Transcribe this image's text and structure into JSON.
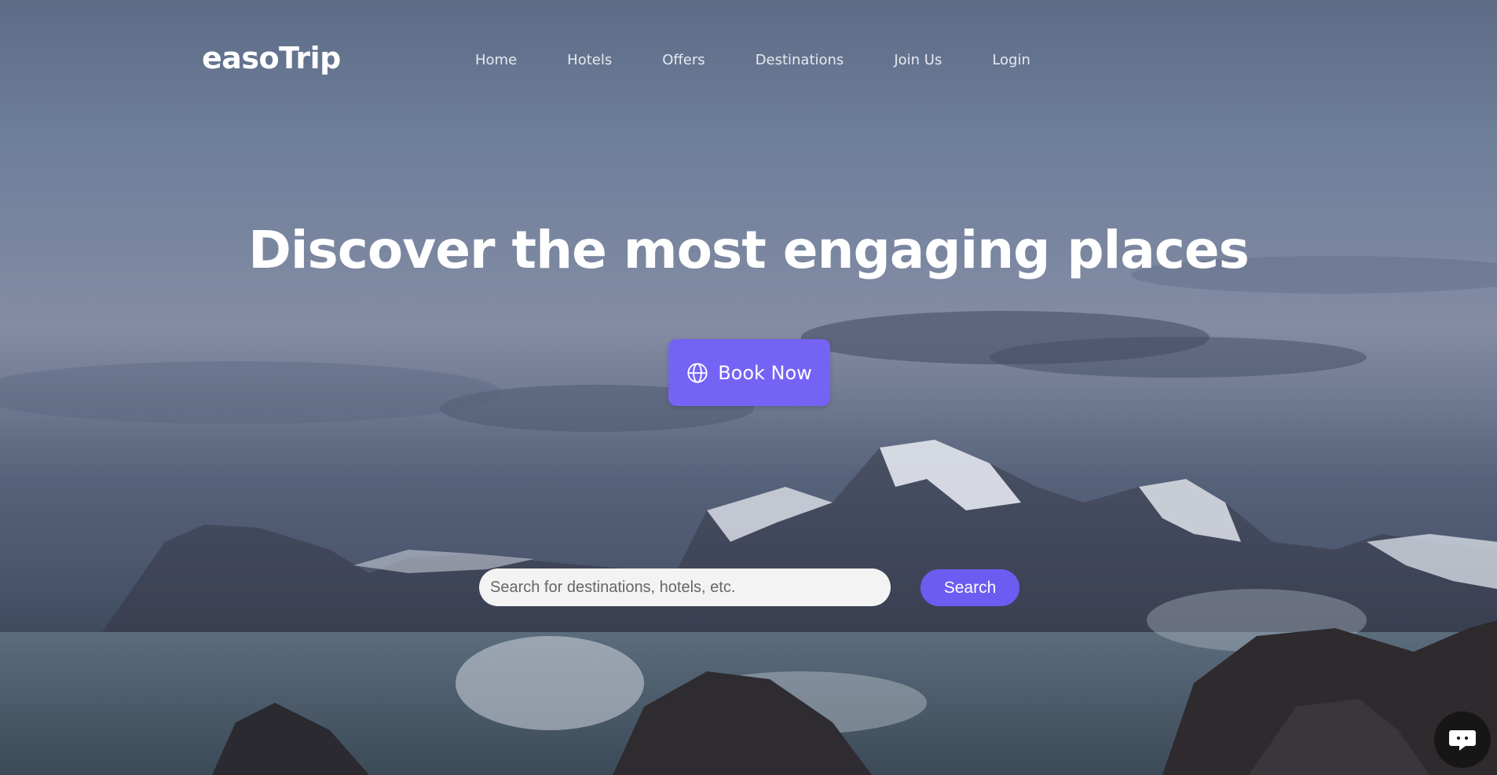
{
  "brand": {
    "logo_text": "easoTrip"
  },
  "nav": {
    "items": [
      {
        "label": "Home"
      },
      {
        "label": "Hotels"
      },
      {
        "label": "Offers"
      },
      {
        "label": "Destinations"
      },
      {
        "label": "Join Us"
      },
      {
        "label": "Login"
      }
    ]
  },
  "hero": {
    "headline": "Discover the most engaging places",
    "book_button_label": "Book Now",
    "book_button_icon": "globe-icon"
  },
  "search": {
    "placeholder": "Search for destinations, hotels, etc.",
    "value": "",
    "button_label": "Search"
  },
  "chat": {
    "icon": "chat-bubble-icon"
  },
  "colors": {
    "accent": "#7563f5",
    "search_button": "#6c5cf1",
    "text_light": "#ffffff",
    "chat_button_bg": "#161616"
  }
}
